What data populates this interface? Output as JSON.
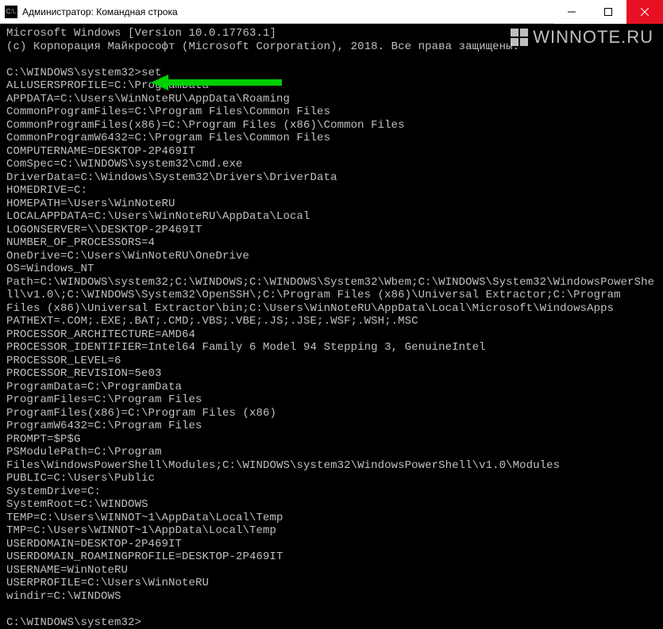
{
  "window": {
    "title": "Администратор: Командная строка",
    "icon_label": "C:\\."
  },
  "watermark": {
    "text": "WINNOTE.RU"
  },
  "terminal": {
    "header1": "Microsoft Windows [Version 10.0.17763.1]",
    "header2": "(c) Корпорация Майкрософт (Microsoft Corporation), 2018. Все права защищены.",
    "prompt1": "C:\\WINDOWS\\system32>",
    "command1": "set",
    "env_lines": [
      "ALLUSERSPROFILE=C:\\ProgramData",
      "APPDATA=C:\\Users\\WinNoteRU\\AppData\\Roaming",
      "CommonProgramFiles=C:\\Program Files\\Common Files",
      "CommonProgramFiles(x86)=C:\\Program Files (x86)\\Common Files",
      "CommonProgramW6432=C:\\Program Files\\Common Files",
      "COMPUTERNAME=DESKTOP-2P469IT",
      "ComSpec=C:\\WINDOWS\\system32\\cmd.exe",
      "DriverData=C:\\Windows\\System32\\Drivers\\DriverData",
      "HOMEDRIVE=C:",
      "HOMEPATH=\\Users\\WinNoteRU",
      "LOCALAPPDATA=C:\\Users\\WinNoteRU\\AppData\\Local",
      "LOGONSERVER=\\\\DESKTOP-2P469IT",
      "NUMBER_OF_PROCESSORS=4",
      "OneDrive=C:\\Users\\WinNoteRU\\OneDrive",
      "OS=Windows_NT",
      "Path=C:\\WINDOWS\\system32;C:\\WINDOWS;C:\\WINDOWS\\System32\\Wbem;C:\\WINDOWS\\System32\\WindowsPowerShell\\v1.0\\;C:\\WINDOWS\\System32\\OpenSSH\\;C:\\Program Files (x86)\\Universal Extractor;C:\\Program Files (x86)\\Universal Extractor\\bin;C:\\Users\\WinNoteRU\\AppData\\Local\\Microsoft\\WindowsApps",
      "PATHEXT=.COM;.EXE;.BAT;.CMD;.VBS;.VBE;.JS;.JSE;.WSF;.WSH;.MSC",
      "PROCESSOR_ARCHITECTURE=AMD64",
      "PROCESSOR_IDENTIFIER=Intel64 Family 6 Model 94 Stepping 3, GenuineIntel",
      "PROCESSOR_LEVEL=6",
      "PROCESSOR_REVISION=5e03",
      "ProgramData=C:\\ProgramData",
      "ProgramFiles=C:\\Program Files",
      "ProgramFiles(x86)=C:\\Program Files (x86)",
      "ProgramW6432=C:\\Program Files",
      "PROMPT=$P$G",
      "PSModulePath=C:\\Program Files\\WindowsPowerShell\\Modules;C:\\WINDOWS\\system32\\WindowsPowerShell\\v1.0\\Modules",
      "PUBLIC=C:\\Users\\Public",
      "SystemDrive=C:",
      "SystemRoot=C:\\WINDOWS",
      "TEMP=C:\\Users\\WINNOT~1\\AppData\\Local\\Temp",
      "TMP=C:\\Users\\WINNOT~1\\AppData\\Local\\Temp",
      "USERDOMAIN=DESKTOP-2P469IT",
      "USERDOMAIN_ROAMINGPROFILE=DESKTOP-2P469IT",
      "USERNAME=WinNoteRU",
      "USERPROFILE=C:\\Users\\WinNoteRU",
      "windir=C:\\WINDOWS"
    ],
    "prompt2": "C:\\WINDOWS\\system32>"
  }
}
